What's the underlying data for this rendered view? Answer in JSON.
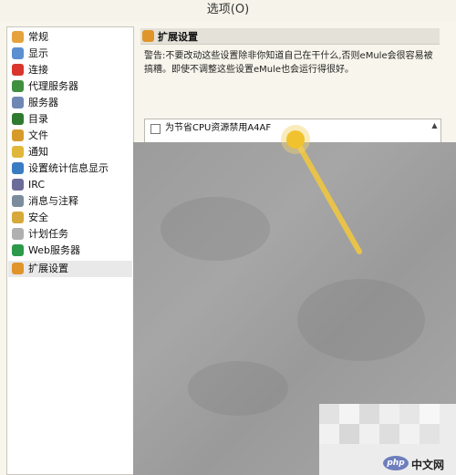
{
  "window": {
    "title": "选项(O)"
  },
  "sidebar": {
    "items": [
      {
        "label": "常规",
        "icon": "settings-icon",
        "color": "#e6a23c"
      },
      {
        "label": "显示",
        "icon": "display-icon",
        "color": "#5b8fd0"
      },
      {
        "label": "连接",
        "icon": "connection-icon",
        "color": "#d9352c"
      },
      {
        "label": "代理服务器",
        "icon": "proxy-icon",
        "color": "#3f8f3f"
      },
      {
        "label": "服务器",
        "icon": "server-icon",
        "color": "#6e88b3"
      },
      {
        "label": "目录",
        "icon": "folder-icon",
        "color": "#2f7a2f"
      },
      {
        "label": "文件",
        "icon": "file-icon",
        "color": "#d79b2b"
      },
      {
        "label": "通知",
        "icon": "notification-icon",
        "color": "#e0b73a"
      },
      {
        "label": "设置统计信息显示",
        "icon": "stats-icon",
        "color": "#3a7cc2"
      },
      {
        "label": "IRC",
        "icon": "irc-icon",
        "color": "#6c6c9a"
      },
      {
        "label": "消息与注释",
        "icon": "message-icon",
        "color": "#7b8c9c"
      },
      {
        "label": "安全",
        "icon": "security-icon",
        "color": "#d6a93a"
      },
      {
        "label": "计划任务",
        "icon": "schedule-icon",
        "color": "#b0b0b0"
      },
      {
        "label": "Web服务器",
        "icon": "web-icon",
        "color": "#2c9a4a"
      },
      {
        "label": "扩展设置",
        "icon": "extended-settings-icon",
        "color": "#e0952a"
      }
    ],
    "selected_index": 14
  },
  "panel": {
    "header": "扩展设置",
    "warning": "警告:不要改动这些设置除非你知道自己在干什么,否则eMule会很容易被搞糟。即使不调整这些设置eMule也会运行得很好。",
    "list": [
      {
        "label": "为节省CPU资源禁用A4AF",
        "checked": false
      }
    ]
  },
  "watermark": {
    "logo": "php",
    "text": "中文网"
  }
}
